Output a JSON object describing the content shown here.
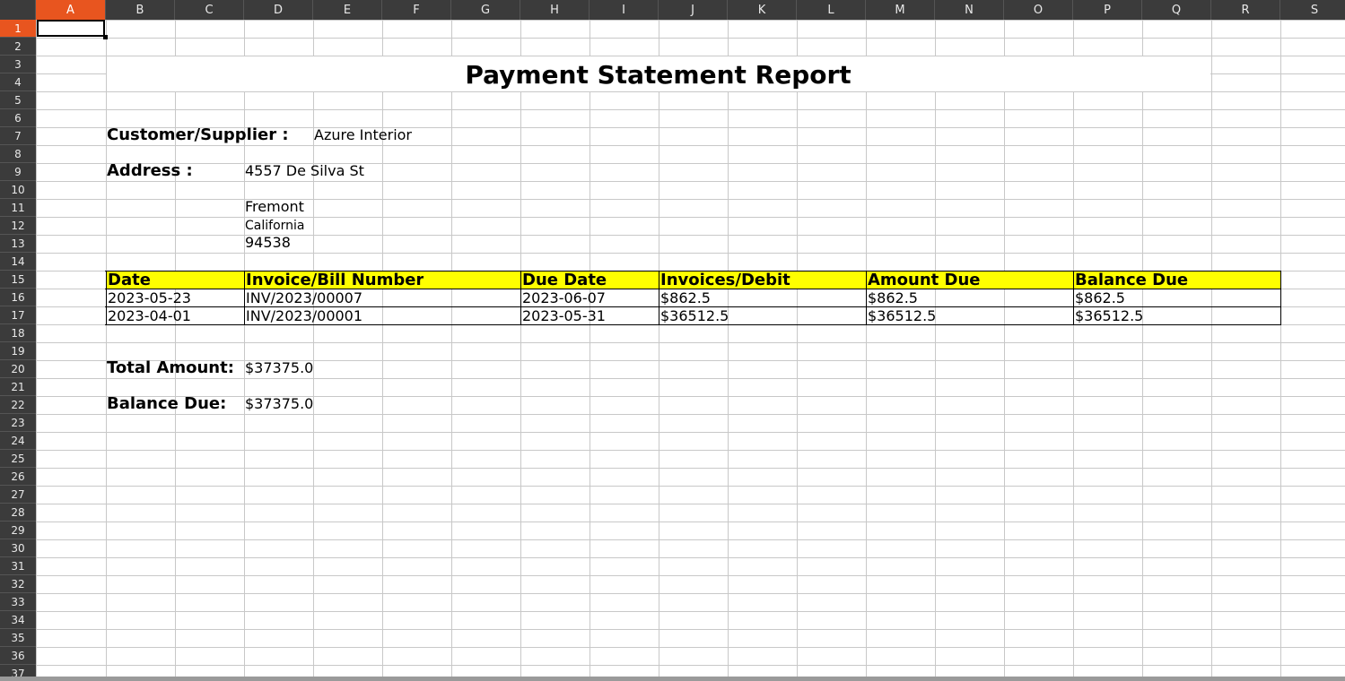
{
  "spreadsheet": {
    "columns": [
      "A",
      "B",
      "C",
      "D",
      "E",
      "F",
      "G",
      "H",
      "I",
      "J",
      "K",
      "L",
      "M",
      "N",
      "O",
      "P",
      "Q",
      "R",
      "S"
    ],
    "rows": [
      "1",
      "2",
      "3",
      "4",
      "5",
      "6",
      "7",
      "8",
      "9",
      "10",
      "11",
      "12",
      "13",
      "14",
      "15",
      "16",
      "17",
      "18",
      "19",
      "20",
      "21",
      "22",
      "23",
      "24",
      "25",
      "26",
      "27",
      "28",
      "29",
      "30",
      "31",
      "32",
      "33",
      "34",
      "35",
      "36",
      "37"
    ],
    "selected_column": "A",
    "selected_row": "1"
  },
  "report": {
    "title": "Payment Statement Report",
    "customer_label": "Customer/Supplier :",
    "customer_value": "Azure Interior",
    "address_label": "Address :",
    "address_line1": "4557 De Silva St",
    "address_city": "Fremont",
    "address_state": "California",
    "address_zip": "94538",
    "table": {
      "header_fill": "#ffff00",
      "headers": [
        "Date",
        "Invoice/Bill Number",
        "Due Date",
        "Invoices/Debit",
        "Amount Due",
        "Balance Due"
      ],
      "rows": [
        [
          "2023-05-23",
          "INV/2023/00007",
          "2023-06-07",
          "$862.5",
          "$862.5",
          "$862.5"
        ],
        [
          "2023-04-01",
          "INV/2023/00001",
          "2023-05-31",
          "$36512.5",
          "$36512.5",
          "$36512.5"
        ]
      ]
    },
    "total_label": "Total Amount:",
    "total_value": "$37375.0",
    "balance_label": "Balance Due:",
    "balance_value": "$37375.0"
  }
}
